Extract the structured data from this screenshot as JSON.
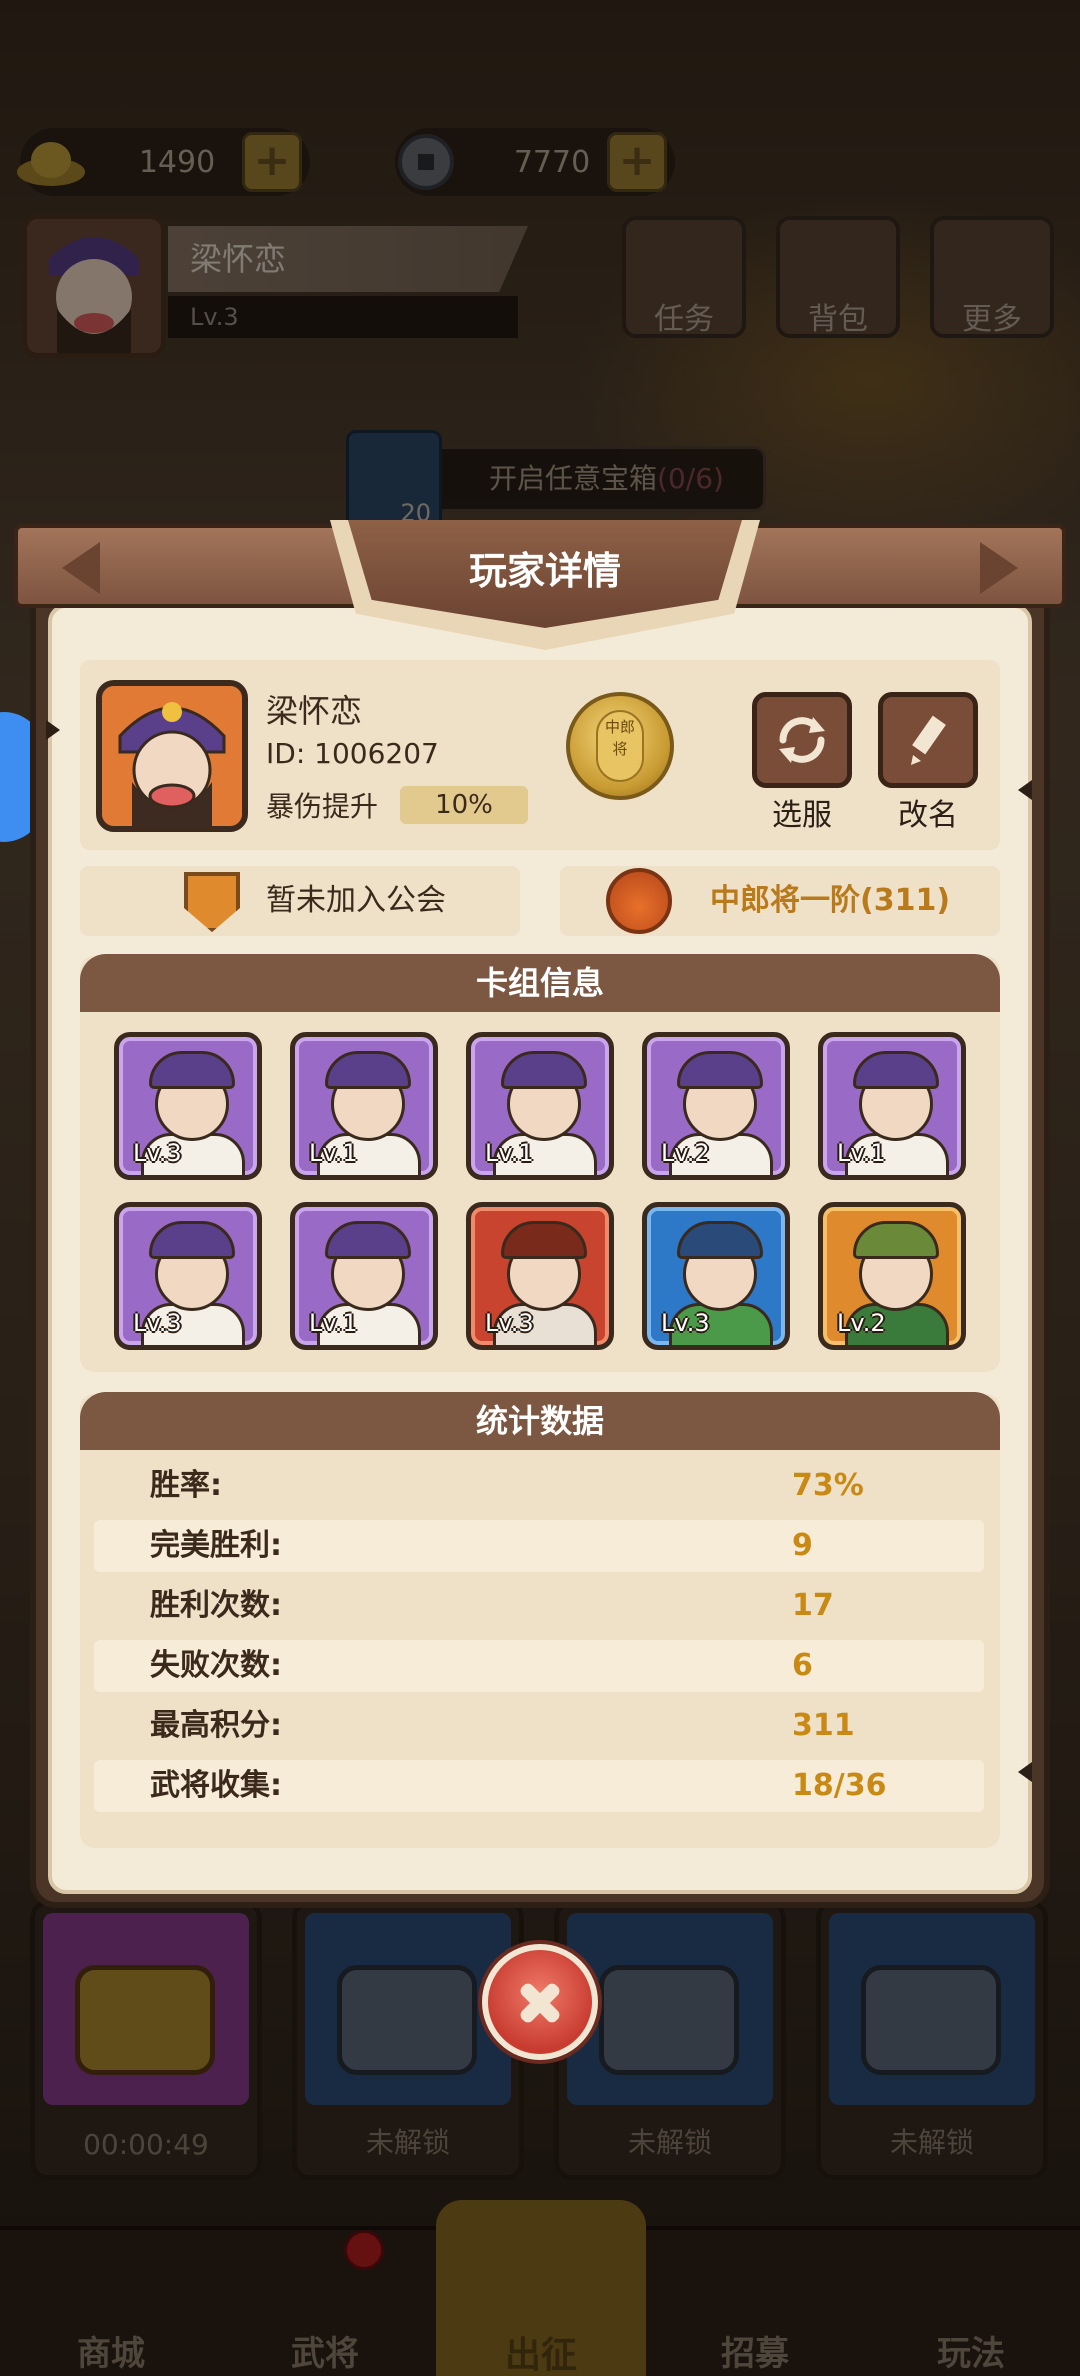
{
  "topbar": {
    "gold": "1490",
    "coins": "7770",
    "plus": "+",
    "player_name": "梁怀恋",
    "player_level": "Lv.3",
    "buttons": {
      "tasks": "任务",
      "bag": "背包",
      "more": "更多"
    }
  },
  "quest": {
    "count": "20",
    "text": "开启任意宝箱",
    "progress": "(0/6)"
  },
  "modal": {
    "title": "玩家详情",
    "player": {
      "name": "梁怀恋",
      "id": "ID: 1006207",
      "crit_label": "暴伤提升",
      "crit_value": "10%",
      "medal_text": "中郎将"
    },
    "buttons": {
      "server": "选服",
      "rename": "改名"
    },
    "guild": "暂未加入公会",
    "rank": "中郎将一阶(311)",
    "deck": {
      "title": "卡组信息",
      "heroes": [
        {
          "level": "Lv.3",
          "rarity": "purple"
        },
        {
          "level": "Lv.1",
          "rarity": "purple"
        },
        {
          "level": "Lv.1",
          "rarity": "purple"
        },
        {
          "level": "Lv.2",
          "rarity": "purple"
        },
        {
          "level": "Lv.1",
          "rarity": "purple"
        },
        {
          "level": "Lv.3",
          "rarity": "purple"
        },
        {
          "level": "Lv.1",
          "rarity": "purple"
        },
        {
          "level": "Lv.3",
          "rarity": "red"
        },
        {
          "level": "Lv.3",
          "rarity": "blue"
        },
        {
          "level": "Lv.2",
          "rarity": "orange"
        }
      ]
    },
    "stats": {
      "title": "统计数据",
      "rows": [
        {
          "label": "胜率:",
          "value": "73%"
        },
        {
          "label": "完美胜利:",
          "value": "9"
        },
        {
          "label": "胜利次数:",
          "value": "17"
        },
        {
          "label": "失败次数:",
          "value": "6"
        },
        {
          "label": "最高积分:",
          "value": "311"
        },
        {
          "label": "武将收集:",
          "value": "18/36"
        }
      ]
    }
  },
  "chests": [
    {
      "label": "00:00:49",
      "color": "#8a3d8e"
    },
    {
      "label": "未解锁",
      "color": "#2d4f7a"
    },
    {
      "label": "未解锁",
      "color": "#2d4f7a"
    },
    {
      "label": "未解锁",
      "color": "#2d4f7a"
    }
  ],
  "nav": {
    "shop": "商城",
    "heroes": "武将",
    "battle": "出征",
    "recruit": "招募",
    "gameplay": "玩法"
  },
  "colors": {
    "accent_gold": "#c88a14",
    "modal_bg": "#f4ead8",
    "header_brown": "#7c5842",
    "rank_orange": "#b87a1a"
  }
}
